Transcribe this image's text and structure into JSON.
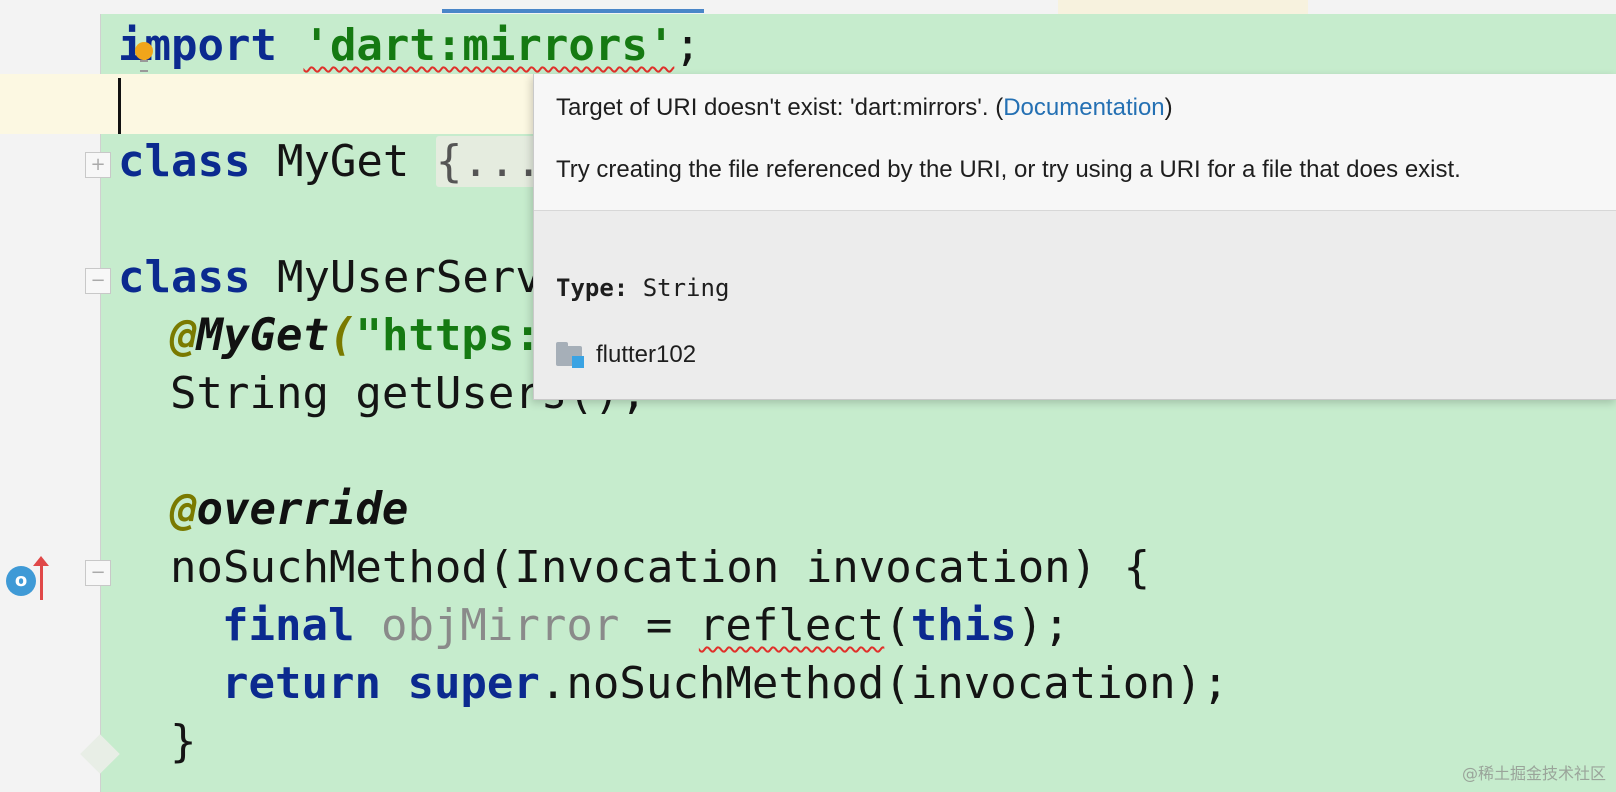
{
  "code": {
    "line1": {
      "kw": "import",
      "string": "'dart:mirrors'",
      "semi": ";"
    },
    "line3": {
      "kw": "class",
      "name": "MyGet",
      "folded": "{..."
    },
    "line5": {
      "kw": "class",
      "name": "MyUserServ"
    },
    "line6": {
      "at": "@",
      "ann": "MyGet",
      "paren": "(",
      "str": "\"https:"
    },
    "line7": {
      "text": "String getUsers();"
    },
    "line9": {
      "at": "@",
      "ann": "override"
    },
    "line10": {
      "text": "noSuchMethod(Invocation invocation) {"
    },
    "line11": {
      "kw": "final",
      "var": "objMirror",
      "eq": " = ",
      "call": "reflect",
      "open": "(",
      "this": "this",
      "close": ");"
    },
    "line12": {
      "kw": "return",
      "kw2": "super",
      "rest": ".noSuchMethod(invocation);"
    },
    "line13": {
      "text": "}"
    }
  },
  "popup": {
    "msg1_prefix": "Target of URI doesn't exist: 'dart:mirrors'. (",
    "msg1_link": "Documentation",
    "msg1_suffix": ")",
    "msg2": "Try creating the file referenced by the URI, or try using a URI for a file that does exist.",
    "type_label": "Type:",
    "type_value": "String",
    "project_name": "flutter102"
  },
  "gutter": {
    "override_marker": "o"
  },
  "icons": {
    "bulb": "lightbulb-icon",
    "folder": "folder-icon",
    "override": "override-icon"
  },
  "colors": {
    "editor_bg": "#c6eccd",
    "keyword": "#0b2a8f",
    "string": "#157a12",
    "link": "#2470b3",
    "error": "#e0302a"
  },
  "watermark": "@稀土掘金技术社区"
}
